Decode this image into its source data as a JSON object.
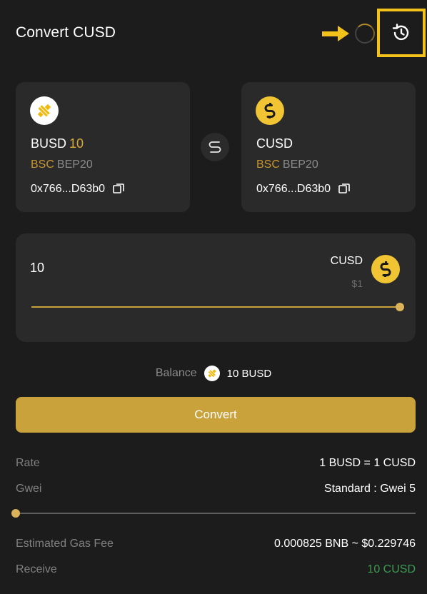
{
  "header": {
    "title": "Convert CUSD"
  },
  "from_token": {
    "symbol": "BUSD",
    "amount": "10",
    "chain": "BSC",
    "standard": "BEP20",
    "address": "0x766...D63b0"
  },
  "to_token": {
    "symbol": "CUSD",
    "chain": "BSC",
    "standard": "BEP20",
    "address": "0x766...D63b0"
  },
  "amount_panel": {
    "value": "10",
    "token": "CUSD",
    "price": "$1",
    "slider_fraction": 1.0
  },
  "balance": {
    "label": "Balance",
    "value": "10 BUSD"
  },
  "convert_button": {
    "label": "Convert"
  },
  "details": {
    "rate_label": "Rate",
    "rate_value": "1 BUSD = 1 CUSD",
    "gwei_label": "Gwei",
    "gwei_value": "Standard : Gwei 5",
    "gwei_slider_fraction": 0.0,
    "gas_label": "Estimated Gas Fee",
    "gas_value": "0.000825 BNB ~ $0.229746",
    "receive_label": "Receive",
    "receive_value": "10 CUSD"
  },
  "colors": {
    "accent": "#caa23b",
    "highlight_box": "#f2c21a",
    "receive_green": "#3e9a53",
    "card_bg": "#2a2a2a",
    "page_bg": "#1c1c1c"
  },
  "icons": [
    "arrow-right-icon",
    "loading-spinner-icon",
    "history-icon",
    "busd-logo-icon",
    "cusd-logo-icon",
    "swap-icon",
    "copy-icon"
  ]
}
